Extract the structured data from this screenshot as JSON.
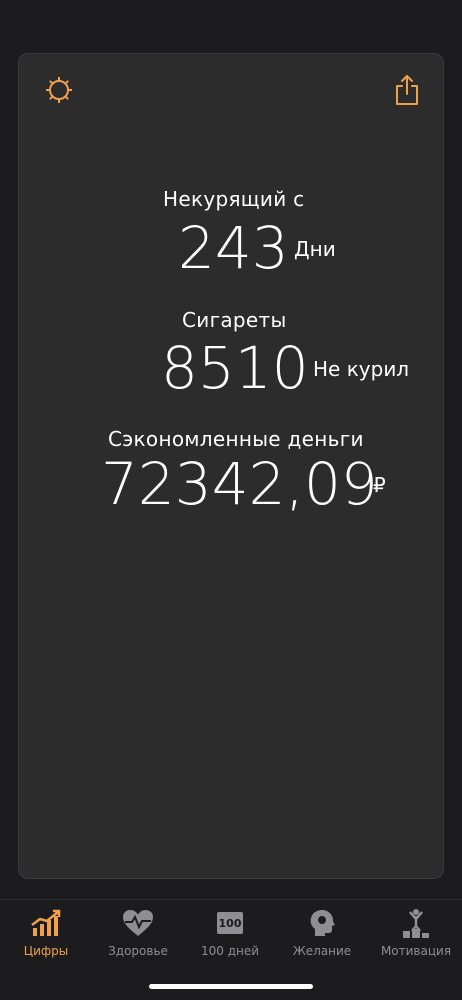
{
  "colors": {
    "accent": "#f0a04b",
    "background": "#1c1c1e",
    "card": "#2c2c2d",
    "text": "#ffffff",
    "tab_inactive": "#8e8e93"
  },
  "header": {
    "settings_icon": "gear-icon",
    "share_icon": "share-icon"
  },
  "stats": {
    "smokefree": {
      "label": "Некурящий с",
      "value": "243",
      "unit": "Дни"
    },
    "cigarettes": {
      "label": "Сигареты",
      "value": "8510",
      "unit": "Не курил"
    },
    "money": {
      "label": "Сэкономленные деньги",
      "value": "72342,09",
      "unit": "₽"
    }
  },
  "tabs": [
    {
      "label": "Цифры",
      "icon": "chart-icon",
      "active": true
    },
    {
      "label": "Здоровье",
      "icon": "heart-icon",
      "active": false
    },
    {
      "label": "100 дней",
      "icon": "hundred-icon",
      "active": false
    },
    {
      "label": "Желание",
      "icon": "head-icon",
      "active": false
    },
    {
      "label": "Мотивация",
      "icon": "trophy-icon",
      "active": false
    }
  ]
}
